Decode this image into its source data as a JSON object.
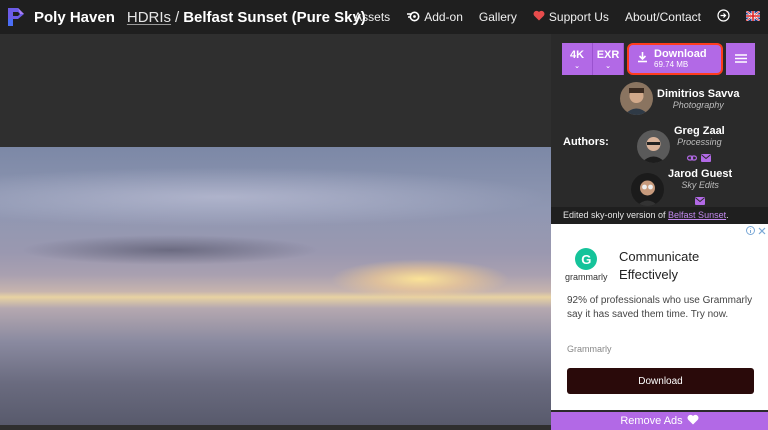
{
  "header": {
    "brand": "Poly Haven",
    "breadcrumb_section": "HDRIs",
    "breadcrumb_sep": "/",
    "page_title": "Belfast Sunset (Pure Sky)"
  },
  "nav": {
    "assets": "Assets",
    "addon": "Add-on",
    "gallery": "Gallery",
    "support": "Support Us",
    "about": "About/Contact"
  },
  "download": {
    "resolution": "4K",
    "format": "EXR",
    "label": "Download",
    "size": "69.74 MB"
  },
  "authors": {
    "label": "Authors:",
    "list": [
      {
        "name": "Dimitrios Savva",
        "role": "Photography"
      },
      {
        "name": "Greg Zaal",
        "role": "Processing"
      },
      {
        "name": "Jarod Guest",
        "role": "Sky Edits"
      }
    ]
  },
  "edited_note": {
    "prefix": "Edited sky-only version of ",
    "link": "Belfast Sunset",
    "suffix": "."
  },
  "ad": {
    "brand_word": "grammarly",
    "headline": "Communicate Effectively",
    "body": "92% of professionals who use Grammarly say it has saved them time. Try now.",
    "brand": "Grammarly",
    "cta": "Download"
  },
  "remove_ads": "Remove Ads",
  "colors": {
    "accent": "#b269e6",
    "highlight": "#ff3c1e",
    "topbar": "#1f1f1f",
    "grammarly_green": "#15c39a"
  }
}
